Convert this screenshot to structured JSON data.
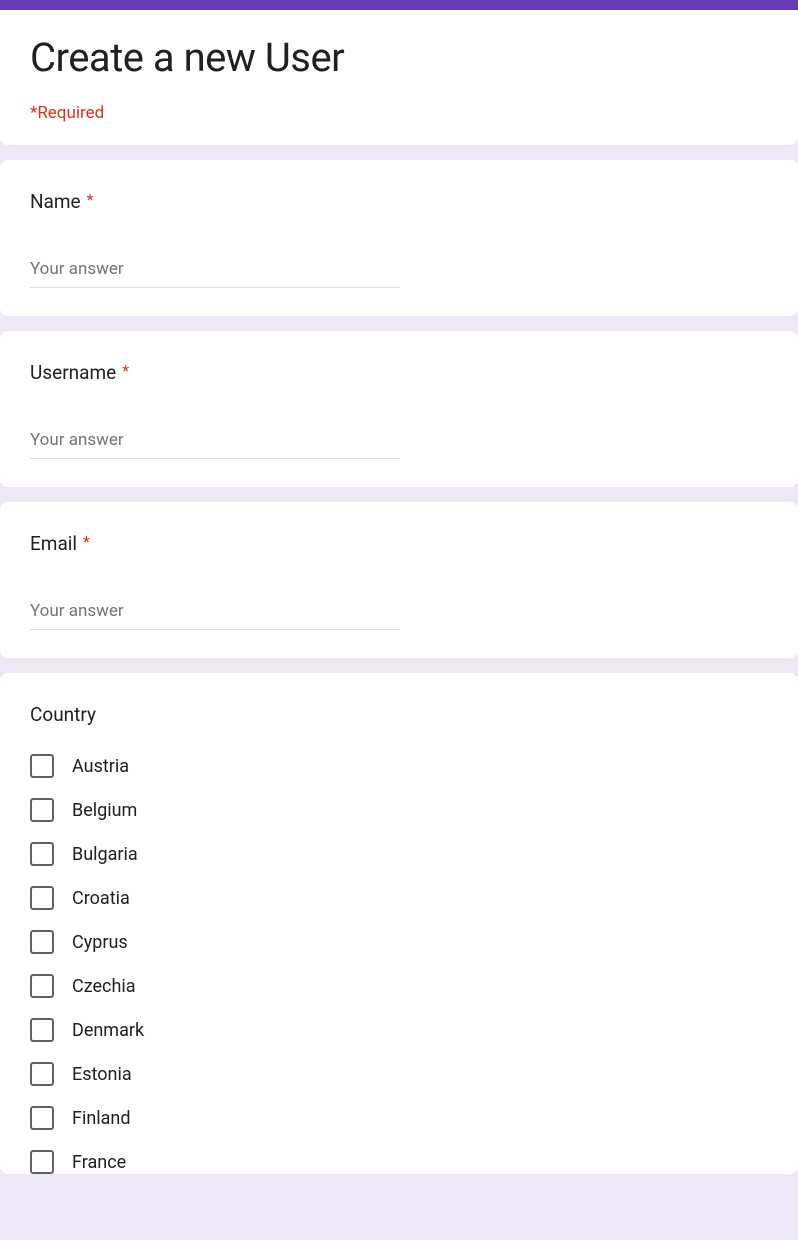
{
  "header": {
    "title": "Create a new User",
    "required_note": "*Required"
  },
  "questions": {
    "name": {
      "label": "Name",
      "required_mark": "*",
      "placeholder": "Your answer"
    },
    "username": {
      "label": "Username",
      "required_mark": "*",
      "placeholder": "Your answer"
    },
    "email": {
      "label": "Email",
      "required_mark": "*",
      "placeholder": "Your answer"
    },
    "country": {
      "label": "Country",
      "options": [
        "Austria",
        "Belgium",
        "Bulgaria",
        "Croatia",
        "Cyprus",
        "Czechia",
        "Denmark",
        "Estonia",
        "Finland",
        "France"
      ]
    }
  }
}
